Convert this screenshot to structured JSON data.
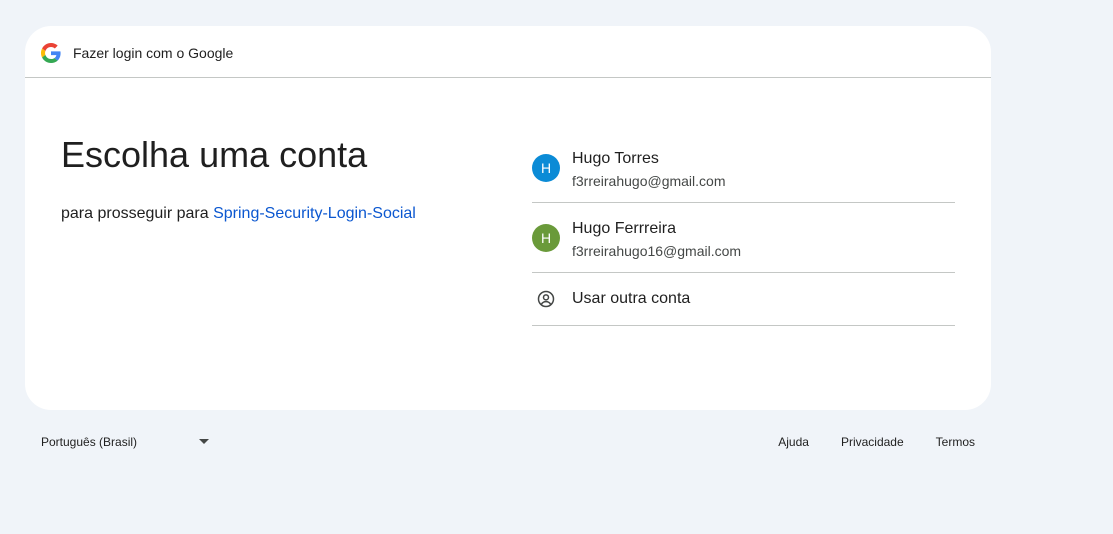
{
  "header": {
    "logo_icon": "google-g-icon",
    "title": "Fazer login com o Google"
  },
  "main": {
    "title": "Escolha uma conta",
    "subtitle_prefix": "para prosseguir para",
    "app_name": "Spring-Security-Login-Social"
  },
  "accounts": [
    {
      "initial": "H",
      "name": "Hugo Torres",
      "email": "f3rreirahugo@gmail.com",
      "avatar_color": "#0b8bd6"
    },
    {
      "initial": "H",
      "name": "Hugo Ferrreira",
      "email": "f3rreirahugo16@gmail.com",
      "avatar_color": "#6a9a3a"
    }
  ],
  "other_account": {
    "icon": "account-circle-icon",
    "label": "Usar outra conta"
  },
  "footer": {
    "language": "Português (Brasil)",
    "links": [
      "Ajuda",
      "Privacidade",
      "Termos"
    ]
  }
}
